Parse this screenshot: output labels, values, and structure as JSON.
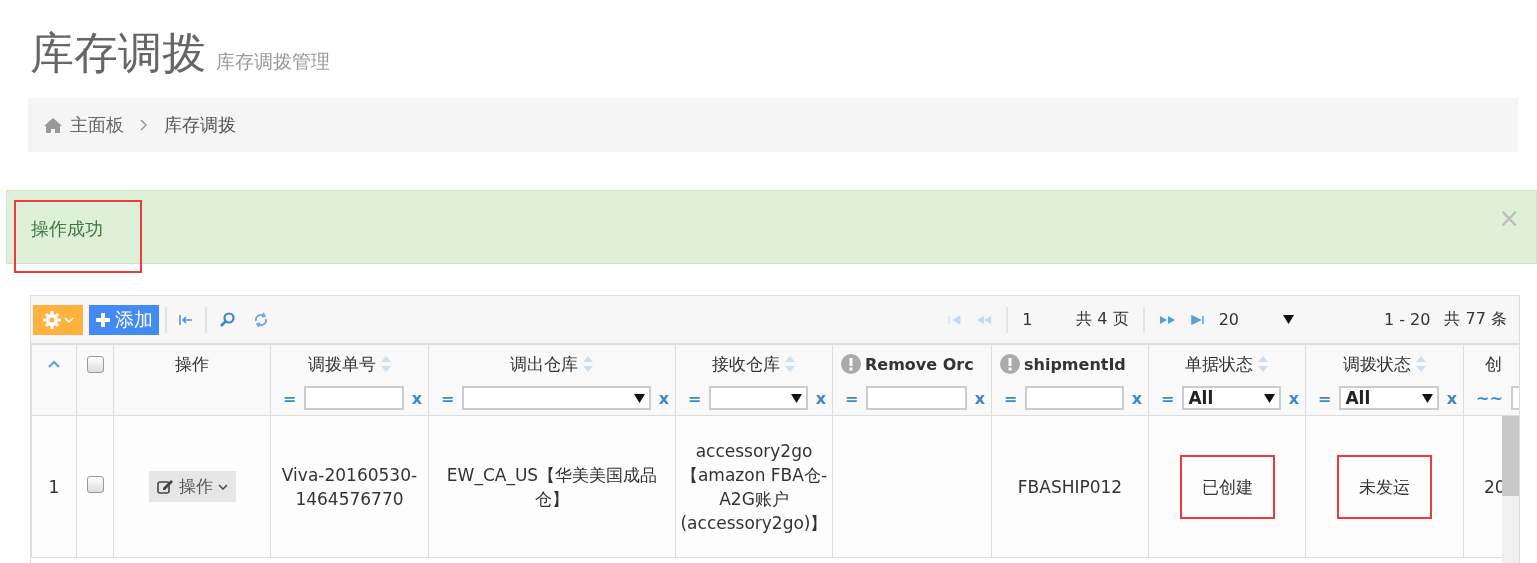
{
  "page": {
    "title": "库存调拨",
    "subtitle": "库存调拨管理"
  },
  "breadcrumb": [
    {
      "label": "主面板"
    },
    {
      "label": "库存调拨"
    }
  ],
  "alert": {
    "message": "操作成功",
    "highlighted": true,
    "close": "×"
  },
  "toolbar": {
    "add_button": "添加"
  },
  "pager": {
    "page": "1",
    "total_pages": "共 4 页",
    "page_size": "20",
    "range": "1 - 20",
    "total": "共 77 条"
  },
  "columns": [
    {
      "kind": "expand"
    },
    {
      "kind": "checkbox",
      "checked": false
    },
    {
      "kind": "text",
      "label": "操作"
    },
    {
      "kind": "text",
      "label": "调拨单号",
      "sortable": true,
      "filter": {
        "kind": "input",
        "op": "=",
        "clear": "x"
      }
    },
    {
      "kind": "text",
      "label": "调出仓库",
      "sortable": true,
      "filter": {
        "kind": "select",
        "op": "=",
        "clear": "x"
      }
    },
    {
      "kind": "text",
      "label": "接收仓库",
      "sortable": true,
      "filter": {
        "kind": "select",
        "op": "=",
        "clear": "x"
      }
    },
    {
      "kind": "info",
      "label": "Remove Orc",
      "filter": {
        "kind": "input",
        "op": "=",
        "clear": "x"
      }
    },
    {
      "kind": "info",
      "label": "shipmentId",
      "filter": {
        "kind": "input",
        "op": "=",
        "clear": "x"
      }
    },
    {
      "kind": "text",
      "label": "单据状态",
      "sortable": true,
      "filter": {
        "kind": "select",
        "op": "=",
        "value": "All",
        "clear": "x"
      }
    },
    {
      "kind": "text",
      "label": "调拨状态",
      "sortable": true,
      "filter": {
        "kind": "select",
        "op": "=",
        "value": "All",
        "clear": "x"
      }
    },
    {
      "kind": "text",
      "label": "创",
      "filter": {
        "kind": "input",
        "op": "~~"
      }
    }
  ],
  "rows": [
    {
      "number": "1",
      "checked": false,
      "action": "操作",
      "cells": [
        {
          "text": "Viva-20160530-1464576770",
          "highlighted": false
        },
        {
          "text": "EW_CA_US【华美美国成品仓】",
          "highlighted": false
        },
        {
          "text": "accessory2go【amazon FBA仓-A2G账户(accessory2go)】",
          "highlighted": false
        },
        {
          "highlighted": false
        },
        {
          "text": "FBASHIP012",
          "highlighted": false
        },
        {
          "text": "已创建",
          "highlighted": true
        },
        {
          "text": "未发运",
          "highlighted": true
        },
        {
          "text": "20",
          "highlighted": false
        }
      ]
    }
  ]
}
